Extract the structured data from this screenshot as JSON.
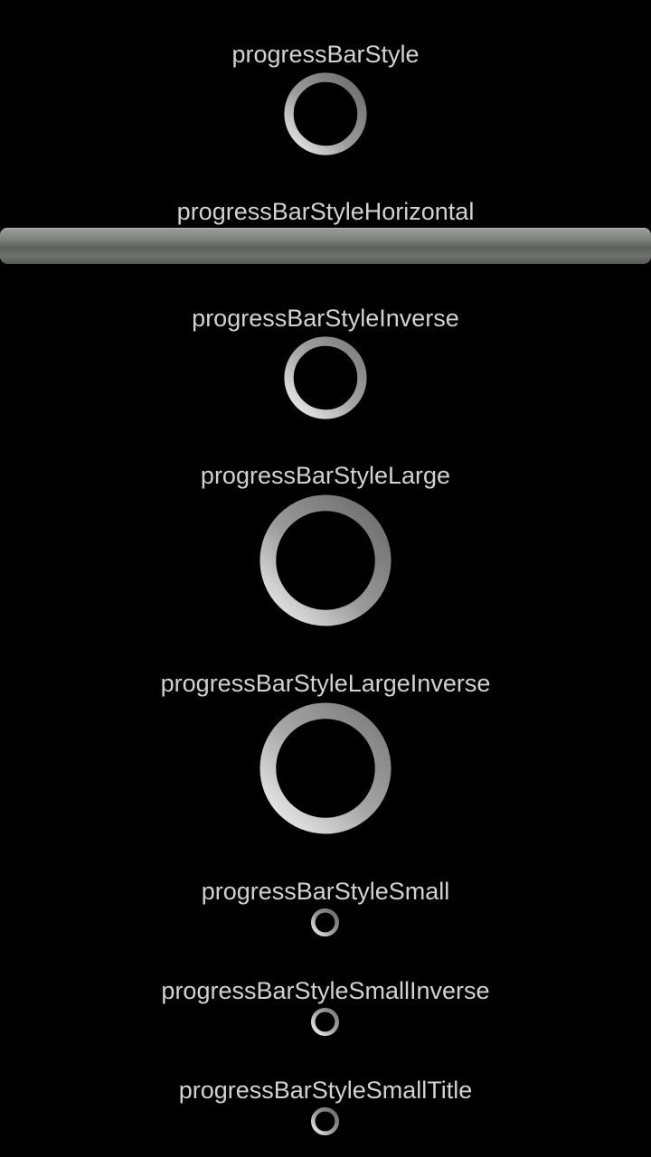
{
  "labels": {
    "default": "progressBarStyle",
    "horizontal": "progressBarStyleHorizontal",
    "inverse": "progressBarStyleInverse",
    "large": "progressBarStyleLarge",
    "large_inverse": "progressBarStyleLargeInverse",
    "small": "progressBarStyleSmall",
    "small_inverse": "progressBarStyleSmallInverse",
    "small_title": "progressBarStyleSmallTitle"
  },
  "colors": {
    "background": "#000000",
    "label_text": "#d2d2d2",
    "ring_dark": "#6e6e6e",
    "ring_light": "#e6e6e6"
  },
  "icons": {
    "spinner": "loading-spinner-icon",
    "progress_track": "horizontal-progress-track"
  }
}
